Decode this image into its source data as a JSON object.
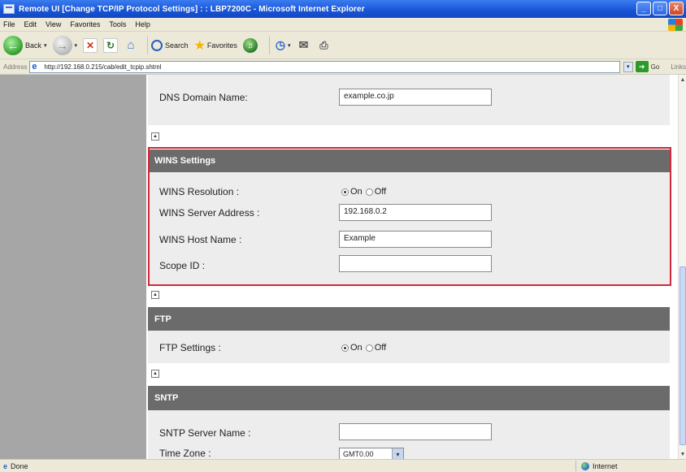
{
  "window": {
    "title": "Remote UI [Change TCP/IP Protocol Settings] : : LBP7200C - Microsoft Internet Explorer",
    "buttons": {
      "minimize": "_",
      "maximize": "□",
      "close": "X"
    }
  },
  "menu": {
    "file": "File",
    "edit": "Edit",
    "view": "View",
    "favorites": "Favorites",
    "tools": "Tools",
    "help": "Help"
  },
  "toolbar": {
    "back": "Back",
    "search": "Search",
    "favorites": "Favorites"
  },
  "address": {
    "label": "Address",
    "url": "http://192.168.0.215/cab/edit_tcpip.shtml",
    "go": "Go",
    "links": "Links"
  },
  "dns": {
    "domain_label": "DNS Domain Name:",
    "domain_value": "example.co.jp"
  },
  "wins": {
    "header": "WINS Settings",
    "resolution_label": "WINS Resolution :",
    "on": "On",
    "off": "Off",
    "server_label": "WINS Server Address :",
    "server_value": "192.168.0.2",
    "host_label": "WINS Host Name :",
    "host_value": "Example",
    "scope_label": "Scope ID :",
    "scope_value": ""
  },
  "ftp": {
    "header": "FTP",
    "settings_label": "FTP Settings :",
    "on": "On",
    "off": "Off"
  },
  "sntp": {
    "header": "SNTP",
    "server_label": "SNTP Server Name :",
    "server_value": "",
    "timezone_label": "Time Zone :",
    "timezone_value": "GMT0.00"
  },
  "status": {
    "left": "Done",
    "zone": "Internet"
  },
  "colors": {
    "section_header": "#6b6b6b",
    "highlight_border": "#d4273a",
    "left_panel": "#a6a6a6"
  }
}
